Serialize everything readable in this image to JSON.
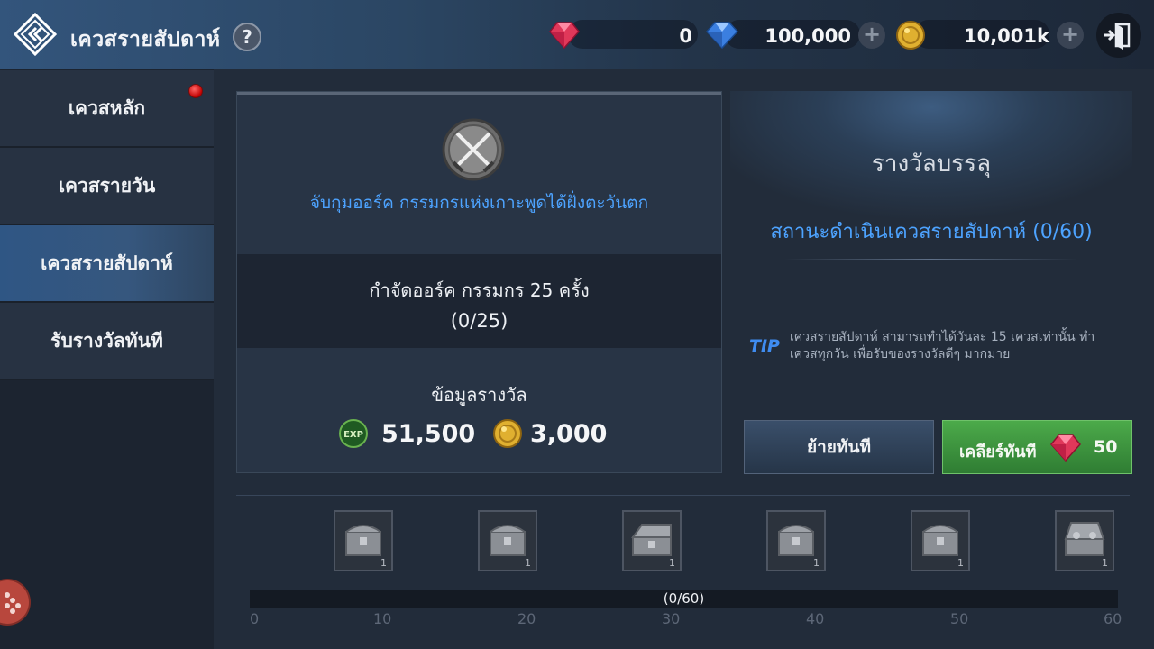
{
  "header": {
    "title": "เควสรายสัปดาห์",
    "help_label": "?",
    "currencies": [
      {
        "icon": "red-gem-icon",
        "value": "0"
      },
      {
        "icon": "blue-gem-icon",
        "value": "100,000"
      },
      {
        "icon": "gold-coin-icon",
        "value": "10,001k"
      }
    ],
    "plus_label": "+"
  },
  "sidebar": {
    "items": [
      {
        "label": "เควสหลัก"
      },
      {
        "label": "เควสรายวัน"
      },
      {
        "label": "เควสรายสัปดาห์"
      },
      {
        "label": "รับรางวัลทันที"
      }
    ]
  },
  "quest": {
    "name": "จับกุมออร์ค กรรมกรแห่งเกาะพูดได้ฝั่งตะวันตก",
    "objective": "กำจัดออร์ค กรรมกร 25 ครั้ง",
    "progress": "(0/25)",
    "reward_title": "ข้อมูลรางวัล",
    "rewards": [
      {
        "icon": "exp-orb-icon",
        "value": "51,500"
      },
      {
        "icon": "gold-coin-icon",
        "value": "3,000"
      }
    ]
  },
  "panel": {
    "title": "รางวัลบรรลุ",
    "status": "สถานะดำเนินเควสรายสัปดาห์ (0/60)",
    "tip_label": "TIP",
    "tip_text": "เควสรายสัปดาห์ สามารถทำได้วันละ 15 เควสเท่านั้น ทำเควสทุกวัน เพื่อรับของรางวัลดีๆ มากมาย",
    "move_button": "ย้ายทันที",
    "clear_button": "เคลียร์ทันที",
    "clear_cost": "50"
  },
  "milestones": {
    "chest_counts": [
      "1",
      "1",
      "1",
      "1",
      "1",
      "1"
    ],
    "progress_label": "(0/60)",
    "progress_fraction": 0,
    "ticks": [
      "0",
      "10",
      "20",
      "30",
      "40",
      "50",
      "60"
    ]
  },
  "colors": {
    "accent_blue": "#4da3ff",
    "clear_green": "#3e9a3f",
    "notification_red": "#d01010"
  }
}
